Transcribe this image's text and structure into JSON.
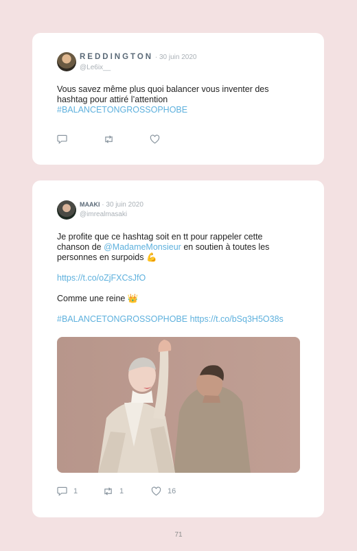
{
  "tweet1": {
    "name": "REDDINGTON",
    "date": " · 30 juin 2020",
    "handle": "@Le6ix__",
    "text_line1": "Vous savez même plus quoi balancer vous inventer des",
    "text_line2": "hashtag pour attiré l’attention",
    "hashtag": "#BALANCETONGROSSOPHOBE"
  },
  "tweet2": {
    "name": "MAAKI",
    "date": " · 30 juin 2020",
    "handle": "@imrealmasaki",
    "text_line1": "Je profite que ce hashtag soit en tt pour rappeler cette",
    "text_pre_mention": "chanson de ",
    "mention": "@MadameMonsieur",
    "text_post_mention": " en soutien à toutes les",
    "text_line3": "personnes en surpoids 💪",
    "link1": "https://t.co/oZjFXCsJfO",
    "text_line5": "Comme une reine 👑",
    "hashtag": "#BALANCETONGROSSOPHOBE",
    "link2": "https://t.co/bSq3H5O38s",
    "reply_count": "1",
    "retweet_count": "1",
    "like_count": "16"
  },
  "page_number": "71",
  "icons": [
    "reply-icon",
    "retweet-icon",
    "like-icon"
  ]
}
